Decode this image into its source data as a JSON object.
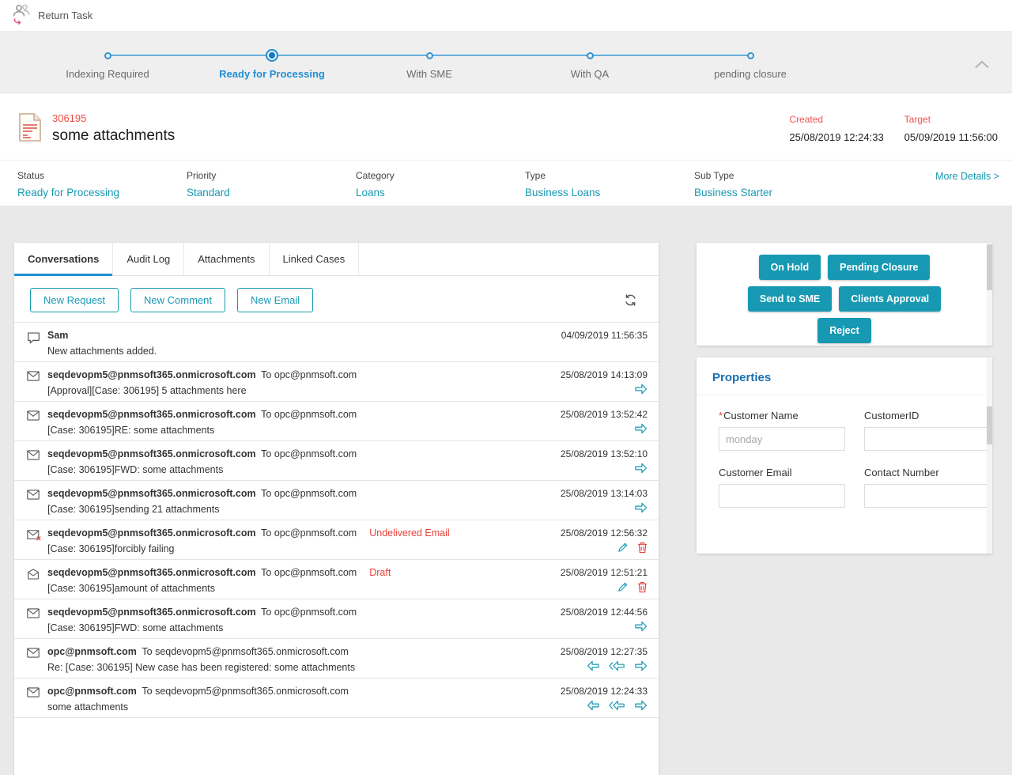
{
  "topbar": {
    "return_task_label": "Return Task"
  },
  "stepper": {
    "steps": [
      {
        "label": "Indexing Required",
        "active": false
      },
      {
        "label": "Ready for Processing",
        "active": true
      },
      {
        "label": "With SME",
        "active": false
      },
      {
        "label": "With QA",
        "active": false
      },
      {
        "label": "pending closure",
        "active": false
      }
    ]
  },
  "case_header": {
    "case_id": "306195",
    "title": "some attachments",
    "created_label": "Created",
    "created_value": "25/08/2019 12:24:33",
    "target_label": "Target",
    "target_value": "05/09/2019 11:56:00"
  },
  "info": {
    "fields": [
      {
        "label": "Status",
        "value": "Ready for Processing"
      },
      {
        "label": "Priority",
        "value": "Standard"
      },
      {
        "label": "Category",
        "value": "Loans"
      },
      {
        "label": "Type",
        "value": "Business Loans"
      },
      {
        "label": "Sub Type",
        "value": "Business Starter"
      }
    ],
    "more_details_label": "More Details >"
  },
  "tabs": [
    {
      "label": "Conversations",
      "active": true
    },
    {
      "label": "Audit Log",
      "active": false
    },
    {
      "label": "Attachments",
      "active": false
    },
    {
      "label": "Linked Cases",
      "active": false
    }
  ],
  "toolbar": {
    "buttons": [
      "New Request",
      "New Comment",
      "New Email"
    ]
  },
  "conversations": [
    {
      "type": "comment",
      "sender": "Sam",
      "date": "04/09/2019 11:56:35",
      "subject": "New attachments added.",
      "actions": []
    },
    {
      "type": "email",
      "sender": "seqdevopm5@pnmsoft365.onmicrosoft.com",
      "to_label": "To",
      "recipient": "opc@pnmsoft.com",
      "date": "25/08/2019 14:13:09",
      "subject": "[Approval][Case: 306195] 5 attachments here",
      "actions": [
        "forward"
      ]
    },
    {
      "type": "email",
      "sender": "seqdevopm5@pnmsoft365.onmicrosoft.com",
      "to_label": "To",
      "recipient": "opc@pnmsoft.com",
      "date": "25/08/2019 13:52:42",
      "subject": "[Case: 306195]RE: some attachments",
      "actions": [
        "forward"
      ]
    },
    {
      "type": "email",
      "sender": "seqdevopm5@pnmsoft365.onmicrosoft.com",
      "to_label": "To",
      "recipient": "opc@pnmsoft.com",
      "date": "25/08/2019 13:52:10",
      "subject": "[Case: 306195]FWD: some attachments",
      "actions": [
        "forward"
      ]
    },
    {
      "type": "email",
      "sender": "seqdevopm5@pnmsoft365.onmicrosoft.com",
      "to_label": "To",
      "recipient": "opc@pnmsoft.com",
      "date": "25/08/2019 13:14:03",
      "subject": "[Case: 306195]sending 21 attachments",
      "actions": [
        "forward"
      ]
    },
    {
      "type": "email-failed",
      "sender": "seqdevopm5@pnmsoft365.onmicrosoft.com",
      "to_label": "To",
      "recipient": "opc@pnmsoft.com",
      "status": "Undelivered Email",
      "date": "25/08/2019 12:56:32",
      "subject": "[Case: 306195]forcibly failing",
      "actions": [
        "edit",
        "delete"
      ]
    },
    {
      "type": "email-draft",
      "sender": "seqdevopm5@pnmsoft365.onmicrosoft.com",
      "to_label": "To",
      "recipient": "opc@pnmsoft.com",
      "status": "Draft",
      "date": "25/08/2019 12:51:21",
      "subject": "[Case: 306195]amount of attachments",
      "actions": [
        "edit",
        "delete"
      ]
    },
    {
      "type": "email",
      "sender": "seqdevopm5@pnmsoft365.onmicrosoft.com",
      "to_label": "To",
      "recipient": "opc@pnmsoft.com",
      "date": "25/08/2019 12:44:56",
      "subject": "[Case: 306195]FWD: some attachments",
      "actions": [
        "forward"
      ]
    },
    {
      "type": "email",
      "sender": "opc@pnmsoft.com",
      "to_label": "To",
      "recipient": "seqdevopm5@pnmsoft365.onmicrosoft.com",
      "date": "25/08/2019 12:27:35",
      "subject": "Re: [Case: 306195] New case has been registered: some attachments",
      "actions": [
        "reply",
        "replyall",
        "forward"
      ]
    },
    {
      "type": "email",
      "sender": "opc@pnmsoft.com",
      "to_label": "To",
      "recipient": "seqdevopm5@pnmsoft365.onmicrosoft.com",
      "date": "25/08/2019 12:24:33",
      "subject": "some attachments",
      "actions": [
        "reply",
        "replyall",
        "forward"
      ]
    }
  ],
  "actions_panel": {
    "rows": [
      [
        "On Hold",
        "Pending Closure"
      ],
      [
        "Send to SME",
        "Clients Approval"
      ],
      [
        "Reject"
      ]
    ]
  },
  "properties": {
    "title": "Properties",
    "required_mark": "*",
    "fields": [
      {
        "label": "Customer Name",
        "required": true,
        "placeholder": "monday"
      },
      {
        "label": "CustomerID",
        "required": false,
        "placeholder": ""
      },
      {
        "label": "Customer Email",
        "required": false,
        "placeholder": ""
      },
      {
        "label": "Contact Number",
        "required": false,
        "placeholder": ""
      }
    ]
  },
  "icons": {
    "topbar": "return-task-icon",
    "case": "document-icon",
    "list": [
      "comment-icon",
      "email-icon",
      "email-failed-icon",
      "email-draft-icon"
    ],
    "row_actions": [
      "reply-icon",
      "reply-all-icon",
      "forward-icon",
      "edit-icon",
      "delete-icon"
    ],
    "misc": [
      "refresh-icon",
      "chevron-up-icon"
    ]
  },
  "colors": {
    "accent_teal": "#1799b3",
    "accent_blue": "#1e8fd5",
    "alert_red": "#e8403a"
  }
}
